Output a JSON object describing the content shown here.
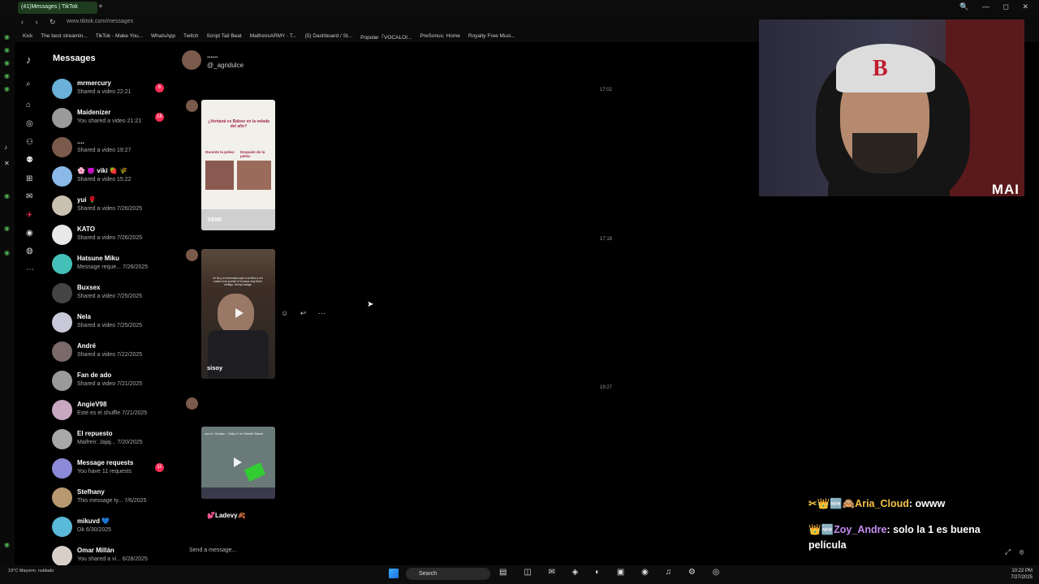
{
  "browser": {
    "tab_title": "(41)Messages | TikTok",
    "new_tab": "+",
    "url": "www.tiktok.com/messages",
    "nav_icons": "‹ › ↻",
    "window_controls": "🔍 — ◻ ✕",
    "bookmarks": [
      "Kick",
      "The best streamin...",
      "TikTok - Make You...",
      "WhatsApp",
      "Twitch",
      "Script Tail Beat",
      "MaifrensARMY - T...",
      "(5) Dashboard / St...",
      "Popular「VOCALOI...",
      "PreSonus: Home",
      "Royalty Free Musi..."
    ]
  },
  "sidebar": {
    "title": "Messages",
    "conversations": [
      {
        "name": "mrmercury",
        "preview": "Shared a video 22:21",
        "badge": "6",
        "color": "#6ab0d8"
      },
      {
        "name": "Maidenizer",
        "preview": "You shared a video 21:21",
        "badge": "18",
        "color": "#9a9a9a"
      },
      {
        "name": "....",
        "preview": "Shared a video 19:27",
        "badge": "",
        "color": "#7a5a4a"
      },
      {
        "name": "🌸 👿 viki 🍓 🌾",
        "preview": "Shared a video 15:22",
        "badge": "",
        "color": "#8ab8e8"
      },
      {
        "name": "yui 🌹",
        "preview": "Shared a video 7/26/2025",
        "badge": "",
        "color": "#c9c0b0"
      },
      {
        "name": "KATO",
        "preview": "Shared a video 7/26/2025",
        "badge": "",
        "color": "#e8e8e8"
      },
      {
        "name": "Hatsune Miku",
        "preview": "Message reque... 7/26/2025",
        "badge": "",
        "color": "#44c0b8"
      },
      {
        "name": "Buxsex",
        "preview": "Shared a video 7/25/2025",
        "badge": "",
        "color": "#444"
      },
      {
        "name": "Nela",
        "preview": "Shared a video 7/25/2025",
        "badge": "",
        "color": "#c8c8d8"
      },
      {
        "name": "André",
        "preview": "Shared a video 7/22/2025",
        "badge": "",
        "color": "#7a6a6a"
      },
      {
        "name": "Fan de ado",
        "preview": "Shared a video 7/21/2025",
        "badge": "",
        "color": "#9a9a9a"
      },
      {
        "name": "AngieV98",
        "preview": "Este es el shuffle 7/21/2025",
        "badge": "",
        "color": "#c8a8c0"
      },
      {
        "name": "El repuesto",
        "preview": "Maifren: Jajaj... 7/20/2025",
        "badge": "",
        "color": "#a8a8a8"
      },
      {
        "name": "Message requests",
        "preview": "You have 11 requests",
        "badge": "11",
        "color": "#8a8ad8"
      },
      {
        "name": "Stefhany",
        "preview": "This message ty... 7/6/2025",
        "badge": "",
        "color": "#b89870"
      },
      {
        "name": "mikuvd 💙",
        "preview": "Ok 6/30/2025",
        "badge": "",
        "color": "#5ab8d8"
      },
      {
        "name": "Omar Millán",
        "preview": "You shared a vi... 6/28/2025",
        "badge": "",
        "color": "#d8d0c8"
      }
    ]
  },
  "chat": {
    "name": "......",
    "handle": "@_agridulce",
    "timestamps": [
      "17:02",
      "17:18",
      "19:27"
    ],
    "card1": {
      "headline": "¿Ventaná vs Baboo en la velada del año?",
      "left_label": "Durante la pelea:",
      "right_label": "Después de la pelea:",
      "caption": "YAMI"
    },
    "card2": {
      "overlay": "mi tía y el terminado ayer a la Bea a ver cosas si es puede el el pasa muy tiene contigo, tiempo amigo",
      "caption": "sisoy"
    },
    "card3": {
      "overlay": "con A. Gordon · Odia ✔ eh Nestle Shock",
      "caption": "💕Ladevy🍂"
    },
    "actions": "☺ ↩ ⋯",
    "input_placeholder": "Send a message..."
  },
  "stream": {
    "cam_label": "MAI",
    "chat": [
      {
        "badges": "✂👑🆕🙈",
        "user": "Aria_Cloud",
        "text": "owww",
        "color": "#f5c242"
      },
      {
        "badges": "👑🆕",
        "user": "Zoy_Andre",
        "text": "solo la 1 es buena película",
        "color": "#c58df2"
      }
    ],
    "overlay_icons": "⤢ ⊕"
  },
  "taskbar": {
    "weather": "19°C Mayorm. nublado",
    "search": "Search",
    "time": "10:22 PM",
    "date": "7/27/2025",
    "icons": "▤ ◫ ✉ ◈ ◐ ▣ ◉ ♫ ⚙ ◎"
  }
}
